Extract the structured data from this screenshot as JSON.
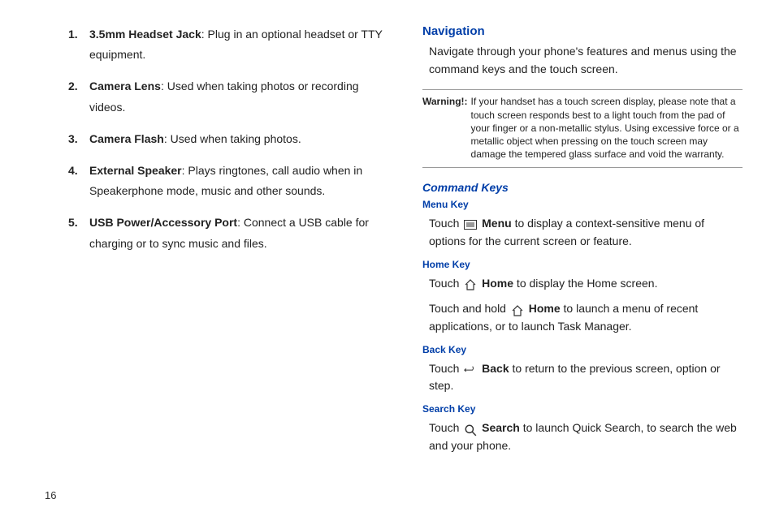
{
  "page_number": "16",
  "left": {
    "items": [
      {
        "term": "3.5mm Headset Jack",
        "desc": ": Plug in an optional headset or TTY equipment."
      },
      {
        "term": "Camera Lens",
        "desc": ": Used when taking photos or recording videos."
      },
      {
        "term": "Camera Flash",
        "desc": ": Used when taking photos."
      },
      {
        "term": "External Speaker",
        "desc": ": Plays ringtones, call audio when in Speakerphone mode, music and other sounds."
      },
      {
        "term": "USB Power/Accessory Port",
        "desc": ": Connect a USB cable for charging or to sync music and files."
      }
    ]
  },
  "right": {
    "nav_heading": "Navigation",
    "nav_intro": "Navigate through your phone's features and menus using the command keys and the touch screen.",
    "warning_label": "Warning!:",
    "warning_text": "If your handset has a touch screen display, please note that a touch screen responds best to a light touch from the pad of your finger or a non-metallic stylus. Using excessive force or a metallic object when pressing on the touch screen may damage the tempered glass surface and void the warranty.",
    "cmd_heading": "Command Keys",
    "menu": {
      "heading": "Menu Key",
      "pre": "Touch ",
      "label": "Menu",
      "post": " to display a context-sensitive menu of options for the current screen or feature."
    },
    "home": {
      "heading": "Home Key",
      "p1_pre": "Touch ",
      "p1_label": "Home",
      "p1_post": " to display the Home screen.",
      "p2_pre": "Touch and hold ",
      "p2_label": "Home",
      "p2_post": " to launch a menu of recent applications, or to launch Task Manager."
    },
    "back": {
      "heading": "Back Key",
      "pre": "Touch ",
      "label": "Back",
      "post": " to return to the previous screen, option or step."
    },
    "search": {
      "heading": "Search Key",
      "pre": "Touch ",
      "label": "Search",
      "post": " to launch Quick Search, to search the web and your phone."
    }
  }
}
